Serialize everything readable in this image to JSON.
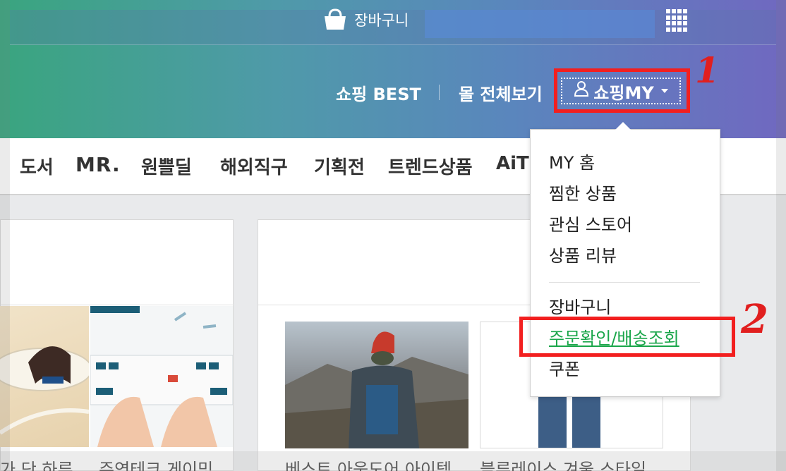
{
  "topbar": {
    "cart_label": "장바구니",
    "cart_icon": "shopping-bag-icon",
    "apps_icon": "grid-apps-icon"
  },
  "nav": {
    "best_label": "쇼핑 BEST",
    "all_label": "몰 전체보기",
    "my_label": "쇼핑MY",
    "my_icon": "person-icon"
  },
  "annotations": {
    "step1": "1",
    "step2": "2",
    "color": "#f21f1f"
  },
  "categories": [
    "도서",
    "MR.",
    "원쁠딜",
    "해외직구",
    "기획전",
    "트렌드상품",
    "AiTEMS"
  ],
  "dropdown": {
    "items": [
      "MY 홈",
      "찜한 상품",
      "관심 스토어",
      "상품 리뷰"
    ],
    "items2": [
      "장바구니",
      "주문확인/배송조회",
      "쿠폰"
    ],
    "highlight_color": "#1aa64a"
  },
  "products": {
    "captions": [
      "가 단 하루",
      "주연테크 게이밍",
      "베스트 아웃도어 아이템",
      "블루레이스 겨울 스타일"
    ]
  },
  "colors": {
    "header_gradient_start": "#3aa57f",
    "header_gradient_end": "#7068c0"
  }
}
